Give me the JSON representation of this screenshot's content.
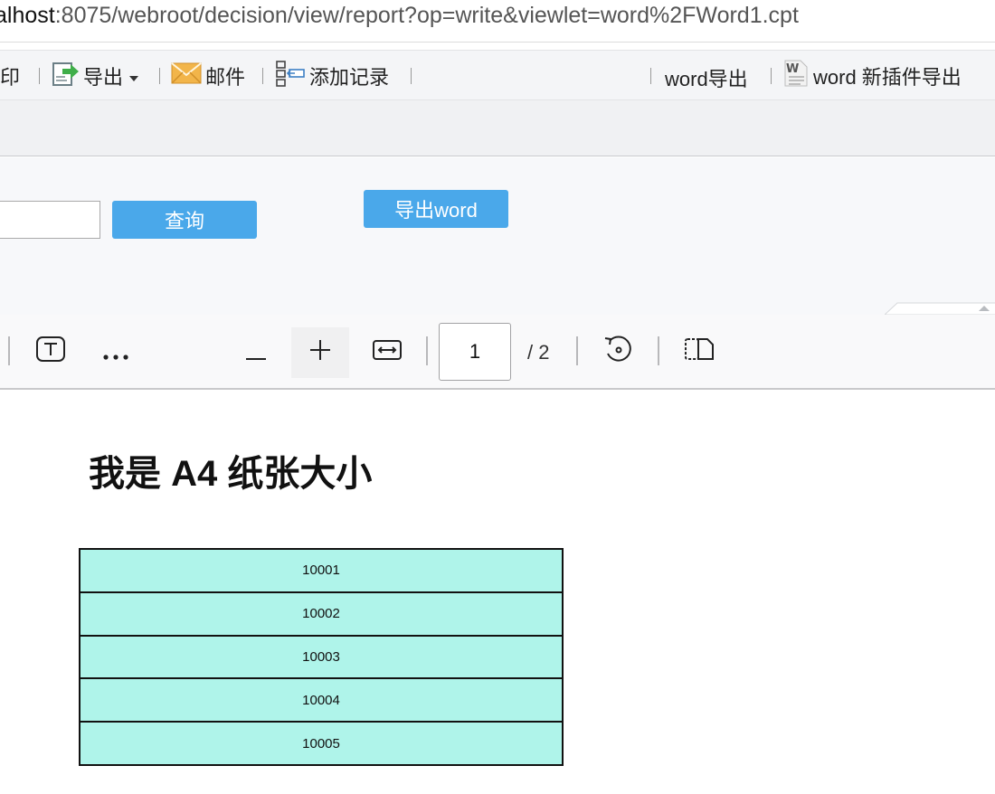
{
  "url": {
    "host_part": "alhost",
    "rest": ":8075/webroot/decision/view/report?op=write&viewlet=word%2FWord1.cpt"
  },
  "toolbar": {
    "print_label_partial": "印",
    "export_label": "导出",
    "mail_label": "邮件",
    "add_record_label": "添加记录",
    "word_export_label": "word导出",
    "word_plugin_export_label": "word 新插件导出"
  },
  "params": {
    "query_button": "查询",
    "export_word_button": "导出word",
    "input_value": ""
  },
  "pdf_toolbar": {
    "page_current": "1",
    "page_total": "/ 2"
  },
  "document": {
    "title": "我是 A4 纸张大小",
    "rows": [
      "10001",
      "10002",
      "10003",
      "10004",
      "10005"
    ]
  },
  "colors": {
    "accent_blue": "#4aa8ea",
    "table_cell": "#aff4ea"
  }
}
